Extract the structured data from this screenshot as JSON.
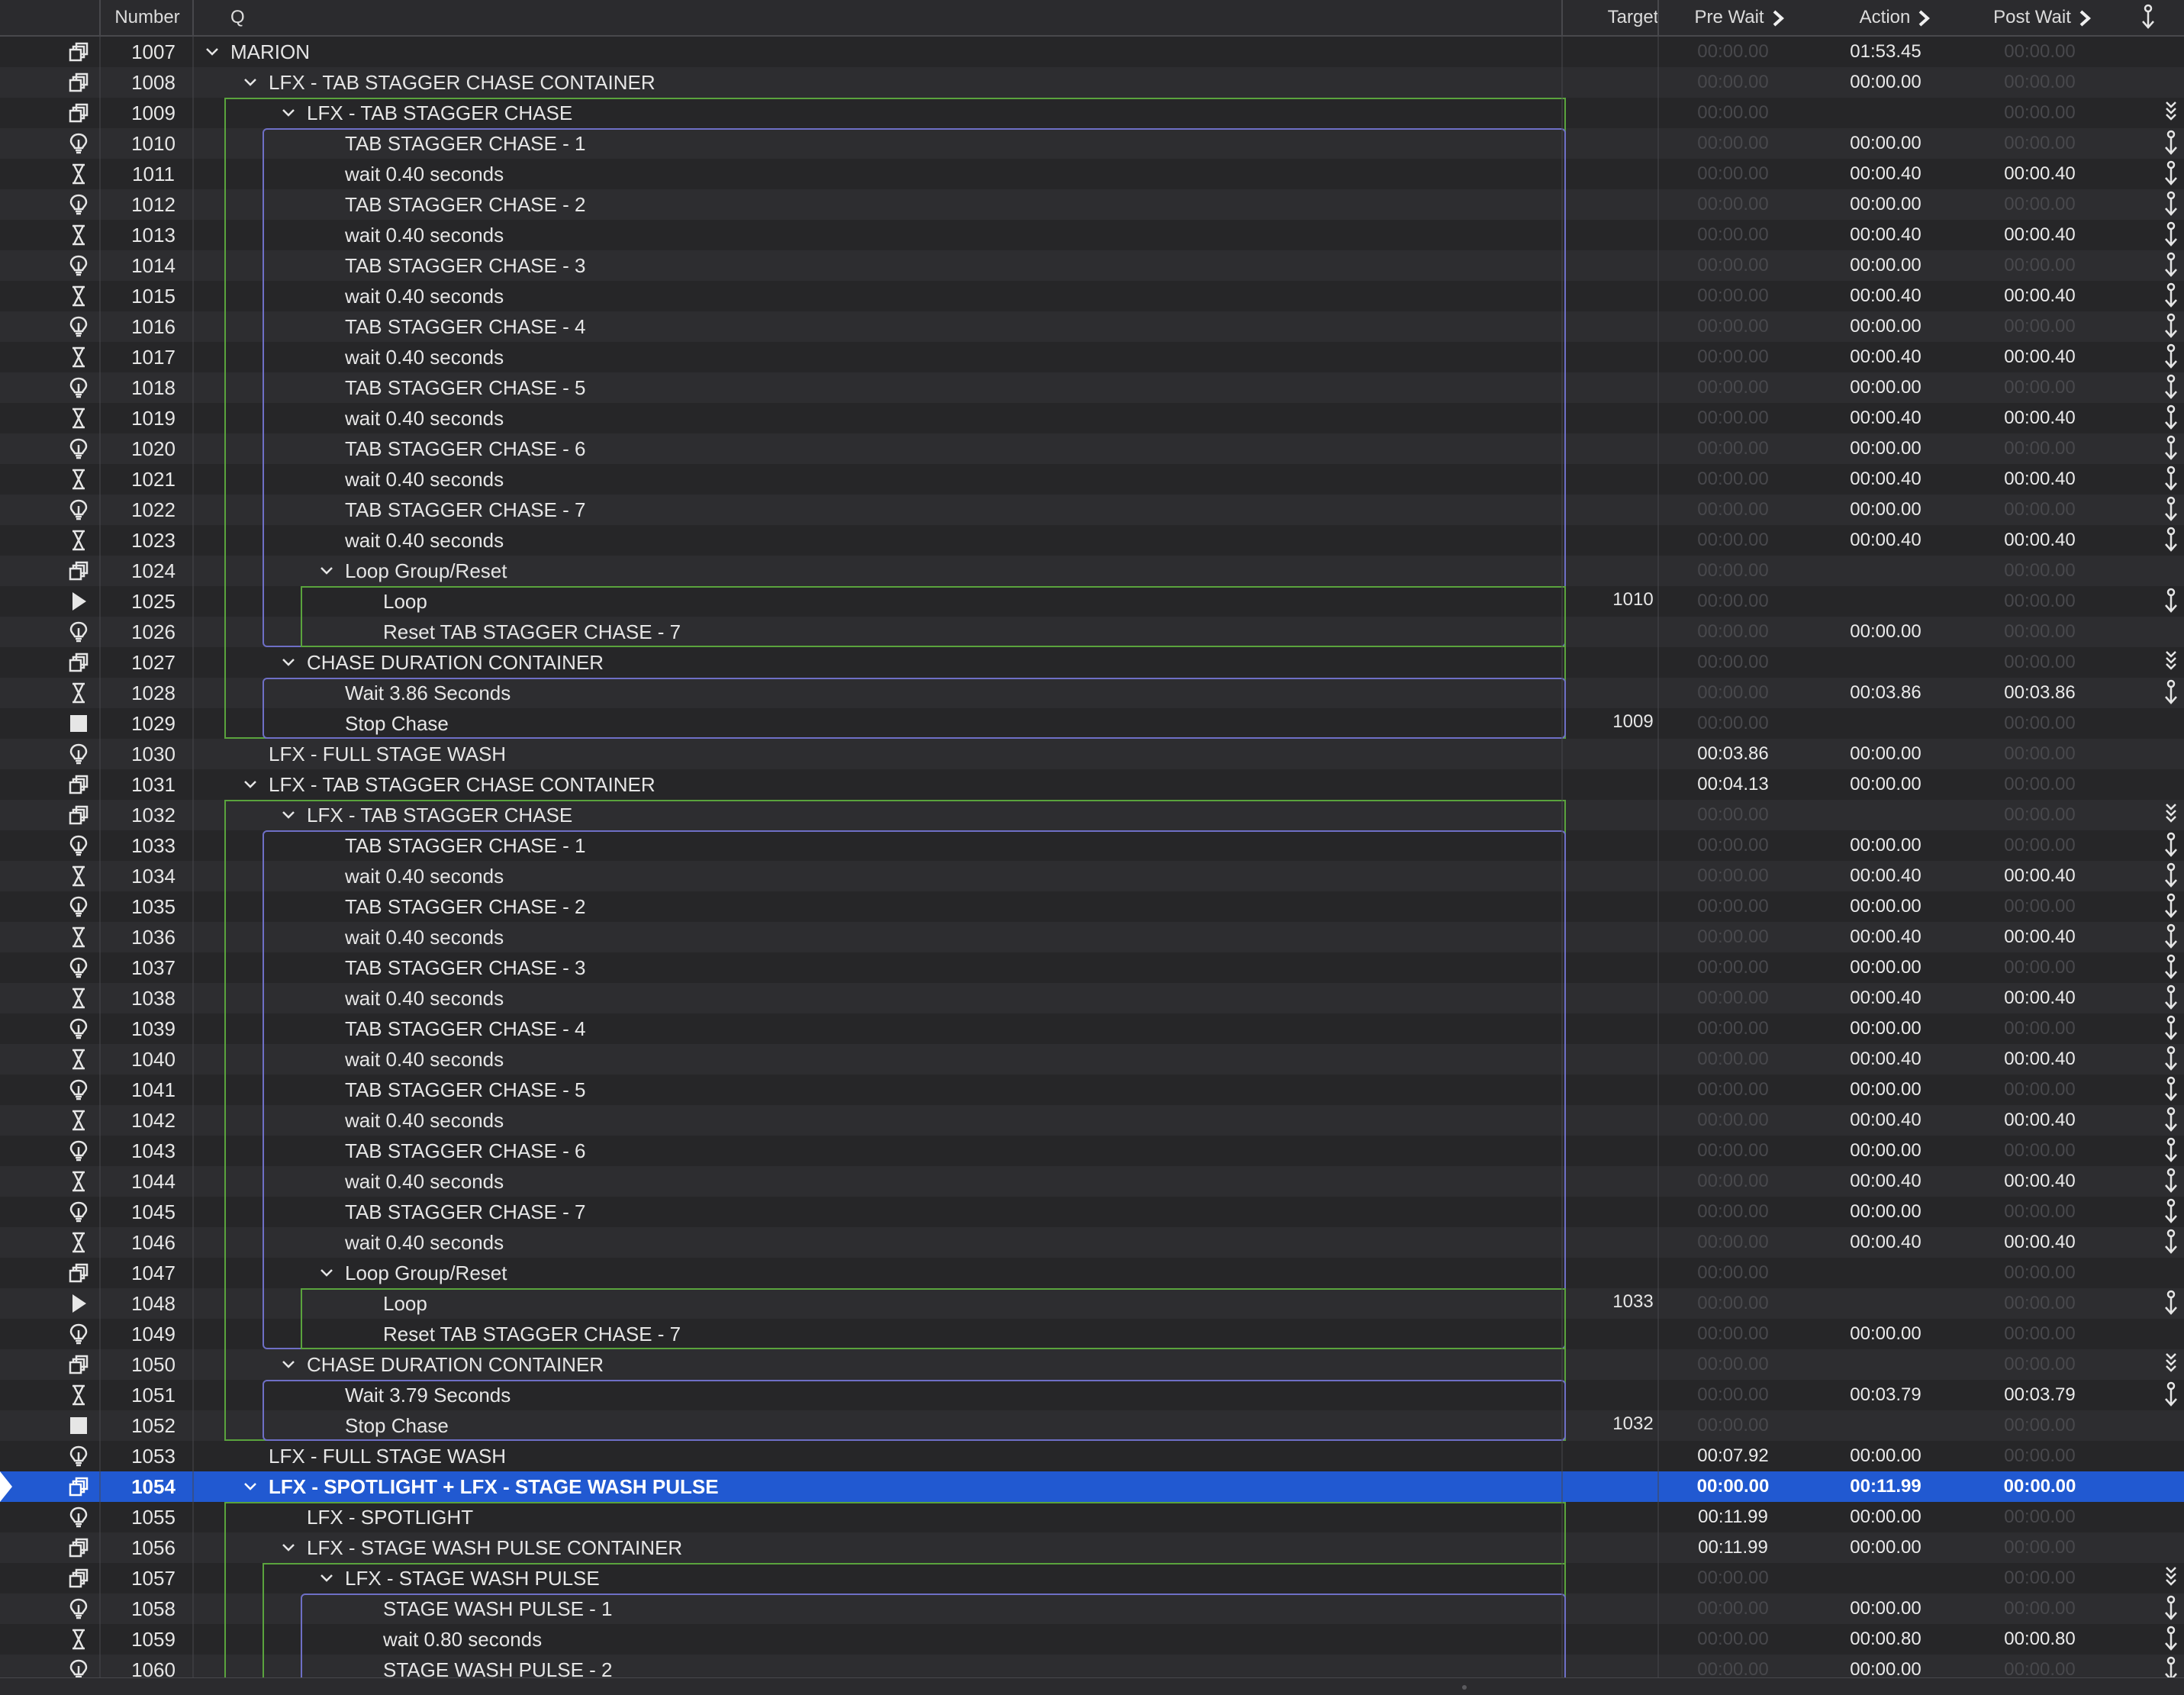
{
  "columns": {
    "number": "Number",
    "q": "Q",
    "target": "Target",
    "pre_wait": "Pre Wait",
    "action": "Action",
    "post_wait": "Post Wait"
  },
  "colors": {
    "selection": "#2159d1",
    "group_border": "#5aa33d",
    "chase_border": "#6e6fc6",
    "dim_time": "#48484c"
  },
  "cues": [
    {
      "number": "1007",
      "name": "MARION",
      "type": "group",
      "depth": 0,
      "expanded": true,
      "target": "",
      "pre": "00:00.00",
      "action": "01:53.45",
      "post": "00:00.00",
      "pre_on": false,
      "action_on": true,
      "post_on": false,
      "cont": ""
    },
    {
      "number": "1008",
      "name": "LFX - TAB STAGGER CHASE CONTAINER",
      "type": "group",
      "depth": 1,
      "expanded": true,
      "target": "",
      "pre": "00:00.00",
      "action": "00:00.00",
      "post": "00:00.00",
      "pre_on": false,
      "action_on": true,
      "post_on": false,
      "cont": ""
    },
    {
      "number": "1009",
      "name": "LFX - TAB STAGGER CHASE",
      "type": "group",
      "depth": 2,
      "expanded": true,
      "target": "",
      "pre": "00:00.00",
      "action": "",
      "post": "00:00.00",
      "pre_on": false,
      "action_on": false,
      "post_on": false,
      "cont": "double"
    },
    {
      "number": "1010",
      "name": "TAB STAGGER CHASE - 1",
      "type": "light",
      "depth": 3,
      "target": "",
      "pre": "00:00.00",
      "action": "00:00.00",
      "post": "00:00.00",
      "pre_on": false,
      "action_on": true,
      "post_on": false,
      "cont": "single"
    },
    {
      "number": "1011",
      "name": "wait 0.40 seconds",
      "type": "wait",
      "depth": 3,
      "target": "",
      "pre": "00:00.00",
      "action": "00:00.40",
      "post": "00:00.40",
      "pre_on": false,
      "action_on": true,
      "post_on": true,
      "cont": "single"
    },
    {
      "number": "1012",
      "name": "TAB STAGGER CHASE - 2",
      "type": "light",
      "depth": 3,
      "target": "",
      "pre": "00:00.00",
      "action": "00:00.00",
      "post": "00:00.00",
      "pre_on": false,
      "action_on": true,
      "post_on": false,
      "cont": "single"
    },
    {
      "number": "1013",
      "name": "wait 0.40 seconds",
      "type": "wait",
      "depth": 3,
      "target": "",
      "pre": "00:00.00",
      "action": "00:00.40",
      "post": "00:00.40",
      "pre_on": false,
      "action_on": true,
      "post_on": true,
      "cont": "single"
    },
    {
      "number": "1014",
      "name": "TAB STAGGER CHASE - 3",
      "type": "light",
      "depth": 3,
      "target": "",
      "pre": "00:00.00",
      "action": "00:00.00",
      "post": "00:00.00",
      "pre_on": false,
      "action_on": true,
      "post_on": false,
      "cont": "single"
    },
    {
      "number": "1015",
      "name": "wait 0.40 seconds",
      "type": "wait",
      "depth": 3,
      "target": "",
      "pre": "00:00.00",
      "action": "00:00.40",
      "post": "00:00.40",
      "pre_on": false,
      "action_on": true,
      "post_on": true,
      "cont": "single"
    },
    {
      "number": "1016",
      "name": "TAB STAGGER CHASE - 4",
      "type": "light",
      "depth": 3,
      "target": "",
      "pre": "00:00.00",
      "action": "00:00.00",
      "post": "00:00.00",
      "pre_on": false,
      "action_on": true,
      "post_on": false,
      "cont": "single"
    },
    {
      "number": "1017",
      "name": "wait 0.40 seconds",
      "type": "wait",
      "depth": 3,
      "target": "",
      "pre": "00:00.00",
      "action": "00:00.40",
      "post": "00:00.40",
      "pre_on": false,
      "action_on": true,
      "post_on": true,
      "cont": "single"
    },
    {
      "number": "1018",
      "name": "TAB STAGGER CHASE - 5",
      "type": "light",
      "depth": 3,
      "target": "",
      "pre": "00:00.00",
      "action": "00:00.00",
      "post": "00:00.00",
      "pre_on": false,
      "action_on": true,
      "post_on": false,
      "cont": "single"
    },
    {
      "number": "1019",
      "name": "wait 0.40 seconds",
      "type": "wait",
      "depth": 3,
      "target": "",
      "pre": "00:00.00",
      "action": "00:00.40",
      "post": "00:00.40",
      "pre_on": false,
      "action_on": true,
      "post_on": true,
      "cont": "single"
    },
    {
      "number": "1020",
      "name": "TAB STAGGER CHASE - 6",
      "type": "light",
      "depth": 3,
      "target": "",
      "pre": "00:00.00",
      "action": "00:00.00",
      "post": "00:00.00",
      "pre_on": false,
      "action_on": true,
      "post_on": false,
      "cont": "single"
    },
    {
      "number": "1021",
      "name": "wait 0.40 seconds",
      "type": "wait",
      "depth": 3,
      "target": "",
      "pre": "00:00.00",
      "action": "00:00.40",
      "post": "00:00.40",
      "pre_on": false,
      "action_on": true,
      "post_on": true,
      "cont": "single"
    },
    {
      "number": "1022",
      "name": "TAB STAGGER CHASE - 7",
      "type": "light",
      "depth": 3,
      "target": "",
      "pre": "00:00.00",
      "action": "00:00.00",
      "post": "00:00.00",
      "pre_on": false,
      "action_on": true,
      "post_on": false,
      "cont": "single"
    },
    {
      "number": "1023",
      "name": "wait 0.40 seconds",
      "type": "wait",
      "depth": 3,
      "target": "",
      "pre": "00:00.00",
      "action": "00:00.40",
      "post": "00:00.40",
      "pre_on": false,
      "action_on": true,
      "post_on": true,
      "cont": "single"
    },
    {
      "number": "1024",
      "name": "Loop Group/Reset",
      "type": "group",
      "depth": 3,
      "expanded": true,
      "target": "",
      "pre": "00:00.00",
      "action": "",
      "post": "00:00.00",
      "pre_on": false,
      "action_on": false,
      "post_on": false,
      "cont": ""
    },
    {
      "number": "1025",
      "name": "Loop",
      "type": "start",
      "depth": 4,
      "target": "1010",
      "pre": "00:00.00",
      "action": "",
      "post": "00:00.00",
      "pre_on": false,
      "action_on": false,
      "post_on": false,
      "cont": "single"
    },
    {
      "number": "1026",
      "name": "Reset TAB STAGGER CHASE - 7",
      "type": "light",
      "depth": 4,
      "target": "",
      "pre": "00:00.00",
      "action": "00:00.00",
      "post": "00:00.00",
      "pre_on": false,
      "action_on": true,
      "post_on": false,
      "cont": ""
    },
    {
      "number": "1027",
      "name": "CHASE DURATION CONTAINER",
      "type": "group",
      "depth": 2,
      "expanded": true,
      "target": "",
      "pre": "00:00.00",
      "action": "",
      "post": "00:00.00",
      "pre_on": false,
      "action_on": false,
      "post_on": false,
      "cont": "double"
    },
    {
      "number": "1028",
      "name": "Wait 3.86 Seconds",
      "type": "wait",
      "depth": 3,
      "target": "",
      "pre": "00:00.00",
      "action": "00:03.86",
      "post": "00:03.86",
      "pre_on": false,
      "action_on": true,
      "post_on": true,
      "cont": "single"
    },
    {
      "number": "1029",
      "name": "Stop Chase",
      "type": "stop",
      "depth": 3,
      "target": "1009",
      "pre": "00:00.00",
      "action": "",
      "post": "00:00.00",
      "pre_on": false,
      "action_on": false,
      "post_on": false,
      "cont": ""
    },
    {
      "number": "1030",
      "name": "LFX - FULL STAGE WASH",
      "type": "light",
      "depth": 1,
      "target": "",
      "pre": "00:03.86",
      "action": "00:00.00",
      "post": "00:00.00",
      "pre_on": true,
      "action_on": true,
      "post_on": false,
      "cont": ""
    },
    {
      "number": "1031",
      "name": "LFX - TAB STAGGER CHASE CONTAINER",
      "type": "group",
      "depth": 1,
      "expanded": true,
      "target": "",
      "pre": "00:04.13",
      "action": "00:00.00",
      "post": "00:00.00",
      "pre_on": true,
      "action_on": true,
      "post_on": false,
      "cont": ""
    },
    {
      "number": "1032",
      "name": "LFX - TAB STAGGER CHASE",
      "type": "group",
      "depth": 2,
      "expanded": true,
      "target": "",
      "pre": "00:00.00",
      "action": "",
      "post": "00:00.00",
      "pre_on": false,
      "action_on": false,
      "post_on": false,
      "cont": "double"
    },
    {
      "number": "1033",
      "name": "TAB STAGGER CHASE - 1",
      "type": "light",
      "depth": 3,
      "target": "",
      "pre": "00:00.00",
      "action": "00:00.00",
      "post": "00:00.00",
      "pre_on": false,
      "action_on": true,
      "post_on": false,
      "cont": "single"
    },
    {
      "number": "1034",
      "name": "wait 0.40 seconds",
      "type": "wait",
      "depth": 3,
      "target": "",
      "pre": "00:00.00",
      "action": "00:00.40",
      "post": "00:00.40",
      "pre_on": false,
      "action_on": true,
      "post_on": true,
      "cont": "single"
    },
    {
      "number": "1035",
      "name": "TAB STAGGER CHASE - 2",
      "type": "light",
      "depth": 3,
      "target": "",
      "pre": "00:00.00",
      "action": "00:00.00",
      "post": "00:00.00",
      "pre_on": false,
      "action_on": true,
      "post_on": false,
      "cont": "single"
    },
    {
      "number": "1036",
      "name": "wait 0.40 seconds",
      "type": "wait",
      "depth": 3,
      "target": "",
      "pre": "00:00.00",
      "action": "00:00.40",
      "post": "00:00.40",
      "pre_on": false,
      "action_on": true,
      "post_on": true,
      "cont": "single"
    },
    {
      "number": "1037",
      "name": "TAB STAGGER CHASE - 3",
      "type": "light",
      "depth": 3,
      "target": "",
      "pre": "00:00.00",
      "action": "00:00.00",
      "post": "00:00.00",
      "pre_on": false,
      "action_on": true,
      "post_on": false,
      "cont": "single"
    },
    {
      "number": "1038",
      "name": "wait 0.40 seconds",
      "type": "wait",
      "depth": 3,
      "target": "",
      "pre": "00:00.00",
      "action": "00:00.40",
      "post": "00:00.40",
      "pre_on": false,
      "action_on": true,
      "post_on": true,
      "cont": "single"
    },
    {
      "number": "1039",
      "name": "TAB STAGGER CHASE - 4",
      "type": "light",
      "depth": 3,
      "target": "",
      "pre": "00:00.00",
      "action": "00:00.00",
      "post": "00:00.00",
      "pre_on": false,
      "action_on": true,
      "post_on": false,
      "cont": "single"
    },
    {
      "number": "1040",
      "name": "wait 0.40 seconds",
      "type": "wait",
      "depth": 3,
      "target": "",
      "pre": "00:00.00",
      "action": "00:00.40",
      "post": "00:00.40",
      "pre_on": false,
      "action_on": true,
      "post_on": true,
      "cont": "single"
    },
    {
      "number": "1041",
      "name": "TAB STAGGER CHASE - 5",
      "type": "light",
      "depth": 3,
      "target": "",
      "pre": "00:00.00",
      "action": "00:00.00",
      "post": "00:00.00",
      "pre_on": false,
      "action_on": true,
      "post_on": false,
      "cont": "single"
    },
    {
      "number": "1042",
      "name": "wait 0.40 seconds",
      "type": "wait",
      "depth": 3,
      "target": "",
      "pre": "00:00.00",
      "action": "00:00.40",
      "post": "00:00.40",
      "pre_on": false,
      "action_on": true,
      "post_on": true,
      "cont": "single"
    },
    {
      "number": "1043",
      "name": "TAB STAGGER CHASE - 6",
      "type": "light",
      "depth": 3,
      "target": "",
      "pre": "00:00.00",
      "action": "00:00.00",
      "post": "00:00.00",
      "pre_on": false,
      "action_on": true,
      "post_on": false,
      "cont": "single"
    },
    {
      "number": "1044",
      "name": "wait 0.40 seconds",
      "type": "wait",
      "depth": 3,
      "target": "",
      "pre": "00:00.00",
      "action": "00:00.40",
      "post": "00:00.40",
      "pre_on": false,
      "action_on": true,
      "post_on": true,
      "cont": "single"
    },
    {
      "number": "1045",
      "name": "TAB STAGGER CHASE - 7",
      "type": "light",
      "depth": 3,
      "target": "",
      "pre": "00:00.00",
      "action": "00:00.00",
      "post": "00:00.00",
      "pre_on": false,
      "action_on": true,
      "post_on": false,
      "cont": "single"
    },
    {
      "number": "1046",
      "name": "wait 0.40 seconds",
      "type": "wait",
      "depth": 3,
      "target": "",
      "pre": "00:00.00",
      "action": "00:00.40",
      "post": "00:00.40",
      "pre_on": false,
      "action_on": true,
      "post_on": true,
      "cont": "single"
    },
    {
      "number": "1047",
      "name": "Loop Group/Reset",
      "type": "group",
      "depth": 3,
      "expanded": true,
      "target": "",
      "pre": "00:00.00",
      "action": "",
      "post": "00:00.00",
      "pre_on": false,
      "action_on": false,
      "post_on": false,
      "cont": ""
    },
    {
      "number": "1048",
      "name": "Loop",
      "type": "start",
      "depth": 4,
      "target": "1033",
      "pre": "00:00.00",
      "action": "",
      "post": "00:00.00",
      "pre_on": false,
      "action_on": false,
      "post_on": false,
      "cont": "single"
    },
    {
      "number": "1049",
      "name": "Reset TAB STAGGER CHASE - 7",
      "type": "light",
      "depth": 4,
      "target": "",
      "pre": "00:00.00",
      "action": "00:00.00",
      "post": "00:00.00",
      "pre_on": false,
      "action_on": true,
      "post_on": false,
      "cont": ""
    },
    {
      "number": "1050",
      "name": "CHASE DURATION CONTAINER",
      "type": "group",
      "depth": 2,
      "expanded": true,
      "target": "",
      "pre": "00:00.00",
      "action": "",
      "post": "00:00.00",
      "pre_on": false,
      "action_on": false,
      "post_on": false,
      "cont": "double"
    },
    {
      "number": "1051",
      "name": "Wait 3.79 Seconds",
      "type": "wait",
      "depth": 3,
      "target": "",
      "pre": "00:00.00",
      "action": "00:03.79",
      "post": "00:03.79",
      "pre_on": false,
      "action_on": true,
      "post_on": true,
      "cont": "single"
    },
    {
      "number": "1052",
      "name": "Stop Chase",
      "type": "stop",
      "depth": 3,
      "target": "1032",
      "pre": "00:00.00",
      "action": "",
      "post": "00:00.00",
      "pre_on": false,
      "action_on": false,
      "post_on": false,
      "cont": ""
    },
    {
      "number": "1053",
      "name": "LFX - FULL STAGE WASH",
      "type": "light",
      "depth": 1,
      "target": "",
      "pre": "00:07.92",
      "action": "00:00.00",
      "post": "00:00.00",
      "pre_on": true,
      "action_on": true,
      "post_on": false,
      "cont": ""
    },
    {
      "number": "1054",
      "name": "LFX - SPOTLIGHT + LFX - STAGE WASH PULSE",
      "type": "group",
      "depth": 1,
      "expanded": true,
      "selected": true,
      "target": "",
      "pre": "00:00.00",
      "action": "00:11.99",
      "post": "00:00.00",
      "pre_on": true,
      "action_on": true,
      "post_on": true,
      "cont": ""
    },
    {
      "number": "1055",
      "name": "LFX - SPOTLIGHT",
      "type": "light",
      "depth": 2,
      "target": "",
      "pre": "00:11.99",
      "action": "00:00.00",
      "post": "00:00.00",
      "pre_on": true,
      "action_on": true,
      "post_on": false,
      "cont": ""
    },
    {
      "number": "1056",
      "name": "LFX - STAGE WASH PULSE CONTAINER",
      "type": "group",
      "depth": 2,
      "expanded": true,
      "target": "",
      "pre": "00:11.99",
      "action": "00:00.00",
      "post": "00:00.00",
      "pre_on": true,
      "action_on": true,
      "post_on": false,
      "cont": ""
    },
    {
      "number": "1057",
      "name": "LFX - STAGE WASH PULSE",
      "type": "group",
      "depth": 3,
      "expanded": true,
      "target": "",
      "pre": "00:00.00",
      "action": "",
      "post": "00:00.00",
      "pre_on": false,
      "action_on": false,
      "post_on": false,
      "cont": "double"
    },
    {
      "number": "1058",
      "name": "STAGE WASH PULSE - 1",
      "type": "light",
      "depth": 4,
      "target": "",
      "pre": "00:00.00",
      "action": "00:00.00",
      "post": "00:00.00",
      "pre_on": false,
      "action_on": true,
      "post_on": false,
      "cont": "single"
    },
    {
      "number": "1059",
      "name": "wait 0.80 seconds",
      "type": "wait",
      "depth": 4,
      "target": "",
      "pre": "00:00.00",
      "action": "00:00.80",
      "post": "00:00.80",
      "pre_on": false,
      "action_on": true,
      "post_on": true,
      "cont": "single"
    },
    {
      "number": "1060",
      "name": "STAGE WASH PULSE - 2",
      "type": "light",
      "depth": 4,
      "target": "",
      "pre": "00:00.00",
      "action": "00:00.00",
      "post": "00:00.00",
      "pre_on": false,
      "action_on": true,
      "post_on": false,
      "cont": "single"
    }
  ]
}
